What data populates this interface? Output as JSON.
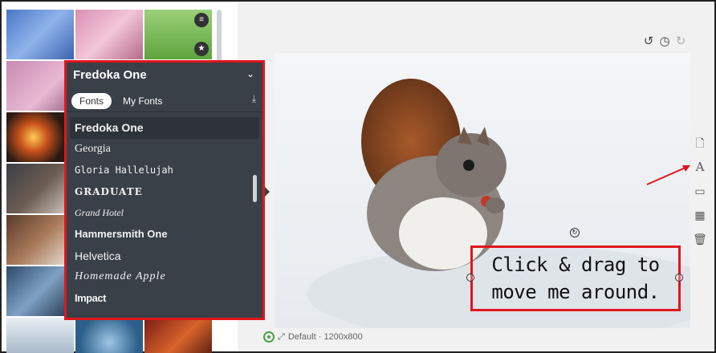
{
  "font_panel": {
    "selected_font": "Fredoka One",
    "tabs": [
      {
        "label": "Fonts",
        "active": true
      },
      {
        "label": "My Fonts",
        "active": false
      }
    ],
    "fonts": [
      "Fredoka One",
      "Georgia",
      "Gloria Hallelujah",
      "GRADUATE",
      "Grand Hotel",
      "Hammersmith One",
      "Helvetica",
      "Homemade Apple",
      "Impact"
    ]
  },
  "canvas": {
    "text_box": {
      "line1": "Click & drag to",
      "line2": "move me around."
    },
    "status": "Default · 1200x800"
  },
  "icons": {
    "history": [
      "undo-icon",
      "history-icon",
      "redo-icon"
    ],
    "side_tools": [
      "page-icon",
      "text-style-icon",
      "frame-icon",
      "grid-icon",
      "trash-icon"
    ]
  },
  "colors": {
    "highlight": "#e0161c",
    "panel_bg": "#3a4048",
    "status_ok": "#47a34a"
  }
}
